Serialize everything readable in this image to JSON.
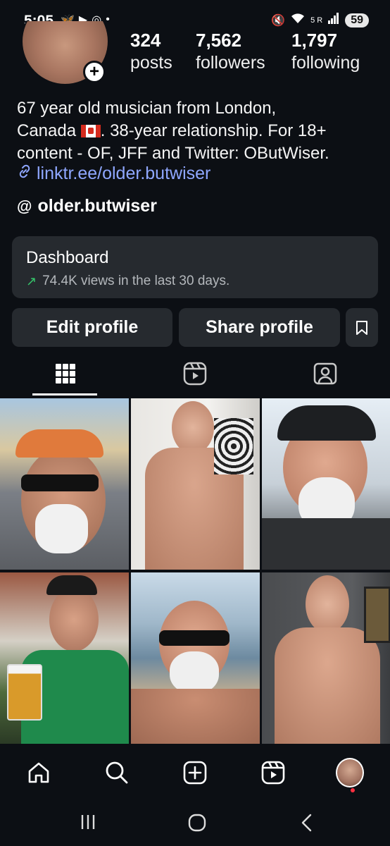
{
  "status_bar": {
    "time": "5:05",
    "signal_label": "5 R",
    "battery": "59"
  },
  "profile": {
    "stats": [
      {
        "value": "324",
        "label": "posts"
      },
      {
        "value": "7,562",
        "label": "followers"
      },
      {
        "value": "1,797",
        "label": "following"
      }
    ],
    "bio": {
      "line1": "67 year old musician from London,",
      "line2_a": "Canada ",
      "line2_b": ". 38-year relationship. For 18+",
      "line3": "content - OF, JFF and Twitter: OButWiser."
    },
    "link": "linktr.ee/older.butwiser",
    "threads_handle": "older.butwiser"
  },
  "dashboard": {
    "title": "Dashboard",
    "subtitle": "74.4K views in the last 30 days."
  },
  "buttons": {
    "edit_profile": "Edit profile",
    "share_profile": "Share profile"
  },
  "tabs": [
    "grid-icon",
    "reels-icon",
    "tagged-icon"
  ],
  "bottom_nav": [
    "home-icon",
    "search-icon",
    "create-icon",
    "reels-icon",
    "profile-avatar"
  ],
  "colors": {
    "background": "#0c0f14",
    "card": "#262a2f",
    "link": "#8fa7ff",
    "trend_green": "#35c46a"
  }
}
